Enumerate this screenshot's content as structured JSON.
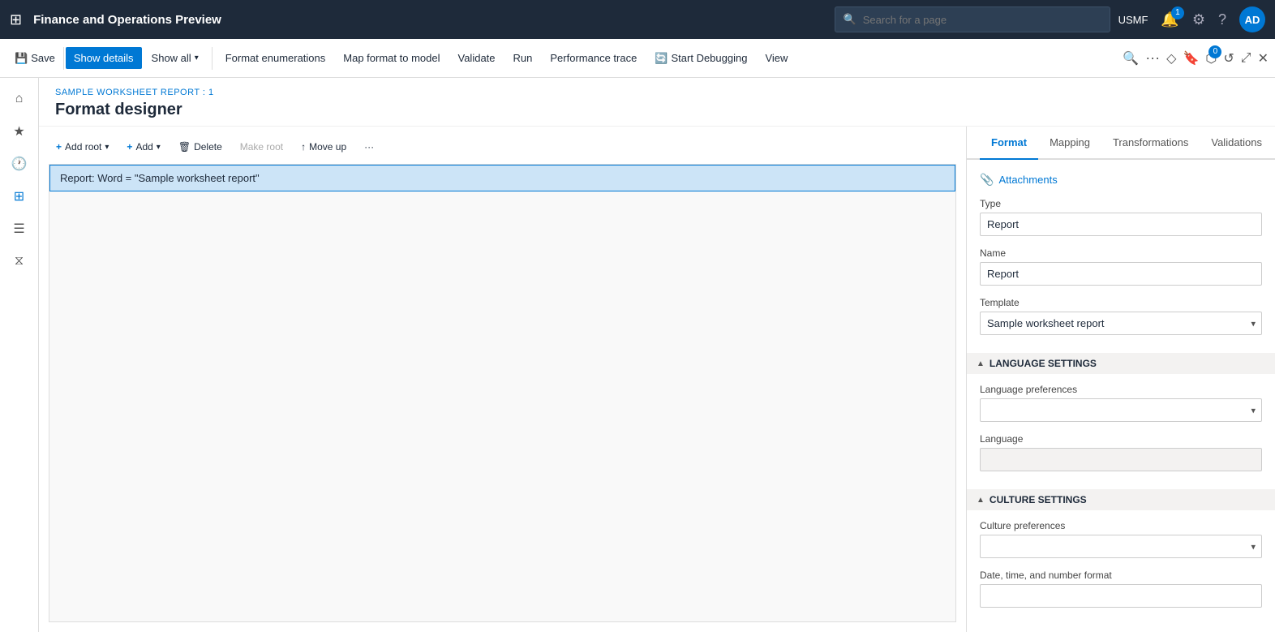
{
  "app": {
    "title": "Finance and Operations Preview"
  },
  "search": {
    "placeholder": "Search for a page"
  },
  "nav": {
    "user": "USMF",
    "notification_count": "1",
    "app_count": "0",
    "avatar": "AD"
  },
  "toolbar": {
    "save_label": "Save",
    "show_details_label": "Show details",
    "show_all_label": "Show all",
    "format_enumerations_label": "Format enumerations",
    "map_format_label": "Map format to model",
    "validate_label": "Validate",
    "run_label": "Run",
    "performance_trace_label": "Performance trace",
    "start_debugging_label": "Start Debugging",
    "view_label": "View"
  },
  "breadcrumb": {
    "label": "SAMPLE WORKSHEET REPORT : 1"
  },
  "page_title": "Format designer",
  "format_toolbar": {
    "add_root_label": "Add root",
    "add_label": "Add",
    "delete_label": "Delete",
    "make_root_label": "Make root",
    "move_up_label": "Move up",
    "more_label": "···"
  },
  "tree": {
    "items": [
      {
        "label": "Report: Word = \"Sample worksheet report\""
      }
    ]
  },
  "tabs": [
    {
      "id": "format",
      "label": "Format",
      "active": true
    },
    {
      "id": "mapping",
      "label": "Mapping",
      "active": false
    },
    {
      "id": "transformations",
      "label": "Transformations",
      "active": false
    },
    {
      "id": "validations",
      "label": "Validations",
      "active": false
    }
  ],
  "properties": {
    "attachments_label": "Attachments",
    "type_label": "Type",
    "type_value": "Report",
    "name_label": "Name",
    "name_value": "Report",
    "template_label": "Template",
    "template_value": "Sample worksheet report",
    "language_settings_label": "LANGUAGE SETTINGS",
    "language_prefs_label": "Language preferences",
    "language_label": "Language",
    "culture_settings_label": "CULTURE SETTINGS",
    "culture_prefs_label": "Culture preferences",
    "datetime_format_label": "Date, time, and number format"
  }
}
